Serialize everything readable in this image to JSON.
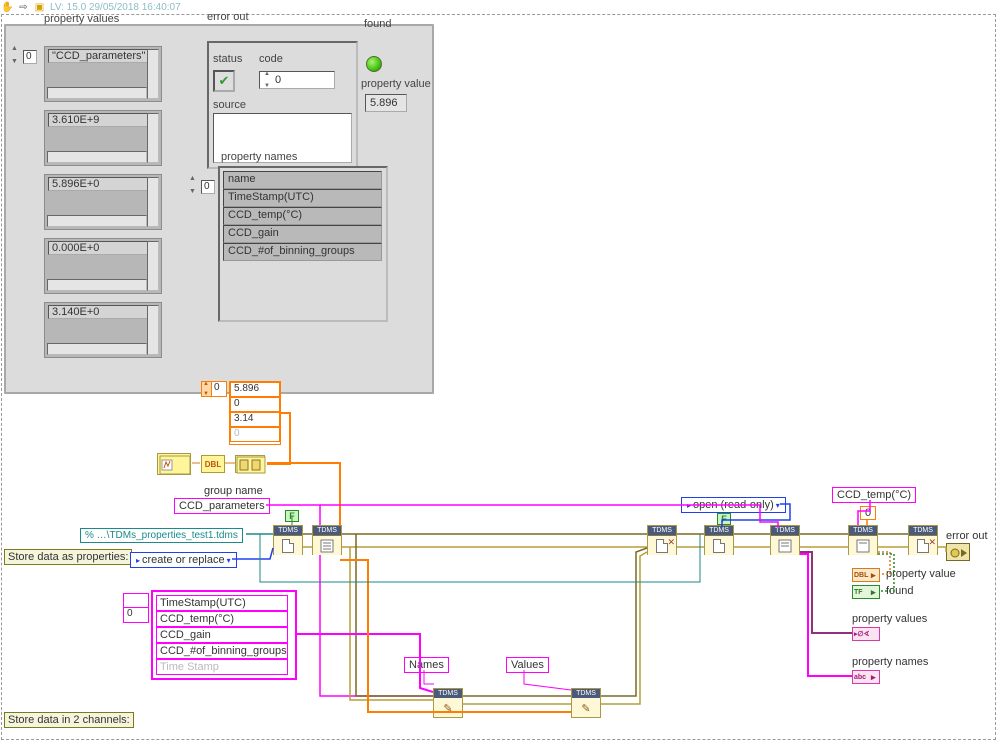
{
  "header": {
    "lv_info": "LV: 15.0 29/05/2018 16:40:07"
  },
  "panel": {
    "prop_values_label": "property values",
    "idx0": "0",
    "values": [
      "\"CCD_parameters\"",
      "3.610E+9",
      "5.896E+0",
      "0.000E+0",
      "3.140E+0"
    ],
    "error_out_label": "error out",
    "status_label": "status",
    "code_label": "code",
    "code_value": "0",
    "source_label": "source",
    "found_label": "found",
    "prop_value_label": "property value",
    "prop_value": "5.896",
    "prop_names_label": "property names",
    "prop_names_idx": "0",
    "prop_names": [
      "name",
      "TimeStamp(UTC)",
      "CCD_temp(°C)",
      "CCD_gain",
      "CCD_#of_binning_groups"
    ]
  },
  "bd": {
    "array_idx": "0",
    "array_vals": [
      "5.896",
      "0",
      "3.14",
      "0"
    ],
    "dbl": "DBL",
    "group_name_label": "group name",
    "group_name": "CCD_parameters",
    "file_path": "% …\\TDMs_properties_test1.tdms",
    "store_props": "Store data as properties:",
    "create_replace": "create or replace",
    "open_ro": "open (read-only)",
    "bool_f": "F",
    "tdms": "TDMS",
    "names_label": "Names",
    "values_label": "Values",
    "ccd_temp_label": "CCD_temp(°C)",
    "zero_const": "0",
    "error_out_label": "error out",
    "prop_value_label": "property value",
    "found_label": "found",
    "prop_values_label": "property values",
    "prop_names_label": "property names",
    "store_2ch": "Store data in 2 channels:",
    "pink_idx": "0",
    "prop_list": [
      "TimeStamp(UTC)",
      "CCD_temp(°C)",
      "CCD_gain",
      "CCD_#of_binning_groups",
      "Time Stamp"
    ],
    "dbl_term": "DBL",
    "tf_term": "TF",
    "abc_term": "abc"
  }
}
